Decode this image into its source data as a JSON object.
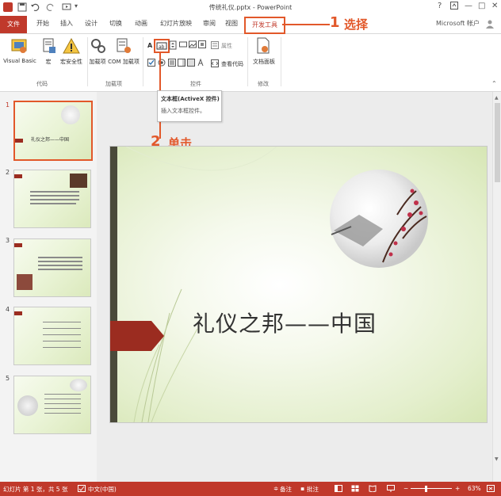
{
  "window": {
    "title": "传统礼仪.pptx - PowerPoint",
    "help": "?",
    "account": "Microsoft 帐户"
  },
  "tabs": [
    {
      "label": "文件"
    },
    {
      "label": "开始"
    },
    {
      "label": "插入"
    },
    {
      "label": "设计"
    },
    {
      "label": "切换"
    },
    {
      "label": "动画"
    },
    {
      "label": "幻灯片放映"
    },
    {
      "label": "审阅"
    },
    {
      "label": "视图"
    },
    {
      "label": "开发工具"
    }
  ],
  "ribbon": {
    "groups": [
      {
        "label": "代码",
        "buttons": [
          "Visual Basic",
          "宏",
          "宏安全性"
        ]
      },
      {
        "label": "加载项",
        "buttons": [
          "加载项",
          "COM 加载项"
        ]
      },
      {
        "label": "控件",
        "buttons": [
          "属性",
          "查看代码"
        ]
      },
      {
        "label": "修改",
        "buttons": [
          "文档面板"
        ]
      }
    ]
  },
  "annotations": {
    "step1_num": "1",
    "step1_text": "选择",
    "step2_num": "2",
    "step2_text": "单击"
  },
  "tooltip": {
    "title": "文本框(ActiveX 控件)",
    "desc": "插入文本框控件。"
  },
  "thumbnails": [
    {
      "num": "1",
      "title": "礼仪之邦——中国"
    },
    {
      "num": "2"
    },
    {
      "num": "3"
    },
    {
      "num": "4"
    },
    {
      "num": "5"
    }
  ],
  "slide": {
    "title": "礼仪之邦——中国"
  },
  "status": {
    "slide_info": "幻灯片 第 1 张，共 5 张",
    "language": "中文(中国)",
    "notes": "备注",
    "comments": "批注",
    "zoom": "63%"
  },
  "colors": {
    "accent": "#c0392b",
    "annotation": "#e2582a",
    "slide_bg": "#e4efcd"
  }
}
